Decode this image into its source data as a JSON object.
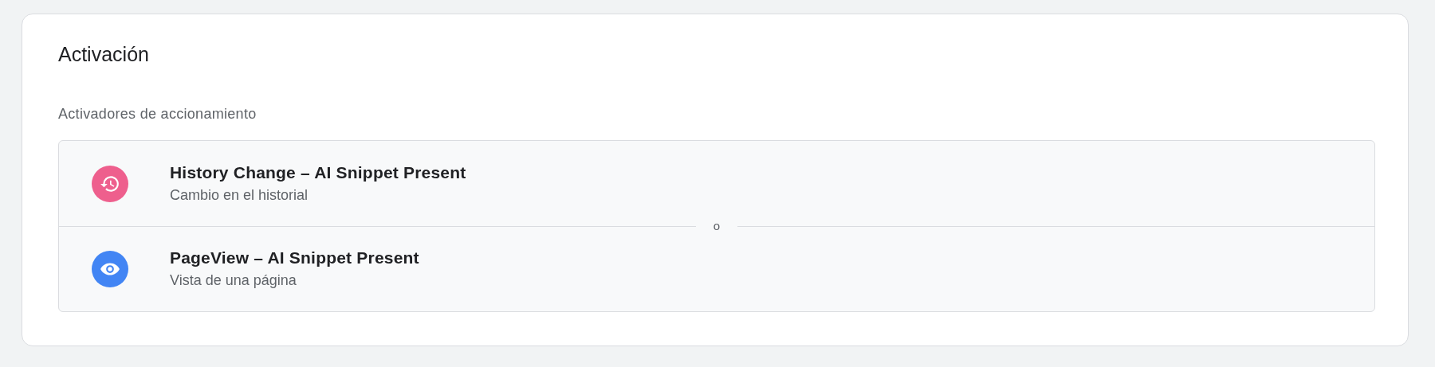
{
  "section": {
    "title": "Activación",
    "subtitle": "Activadores de accionamiento",
    "triggers": [
      {
        "kind": "history",
        "color": "#ee5f8d",
        "name": "History Change – AI Snippet Present",
        "type": "Cambio en el historial"
      },
      {
        "kind": "pageview",
        "color": "#4285f4",
        "name": "PageView – AI Snippet Present",
        "type": "Vista de una página"
      }
    ],
    "separator": "o"
  }
}
